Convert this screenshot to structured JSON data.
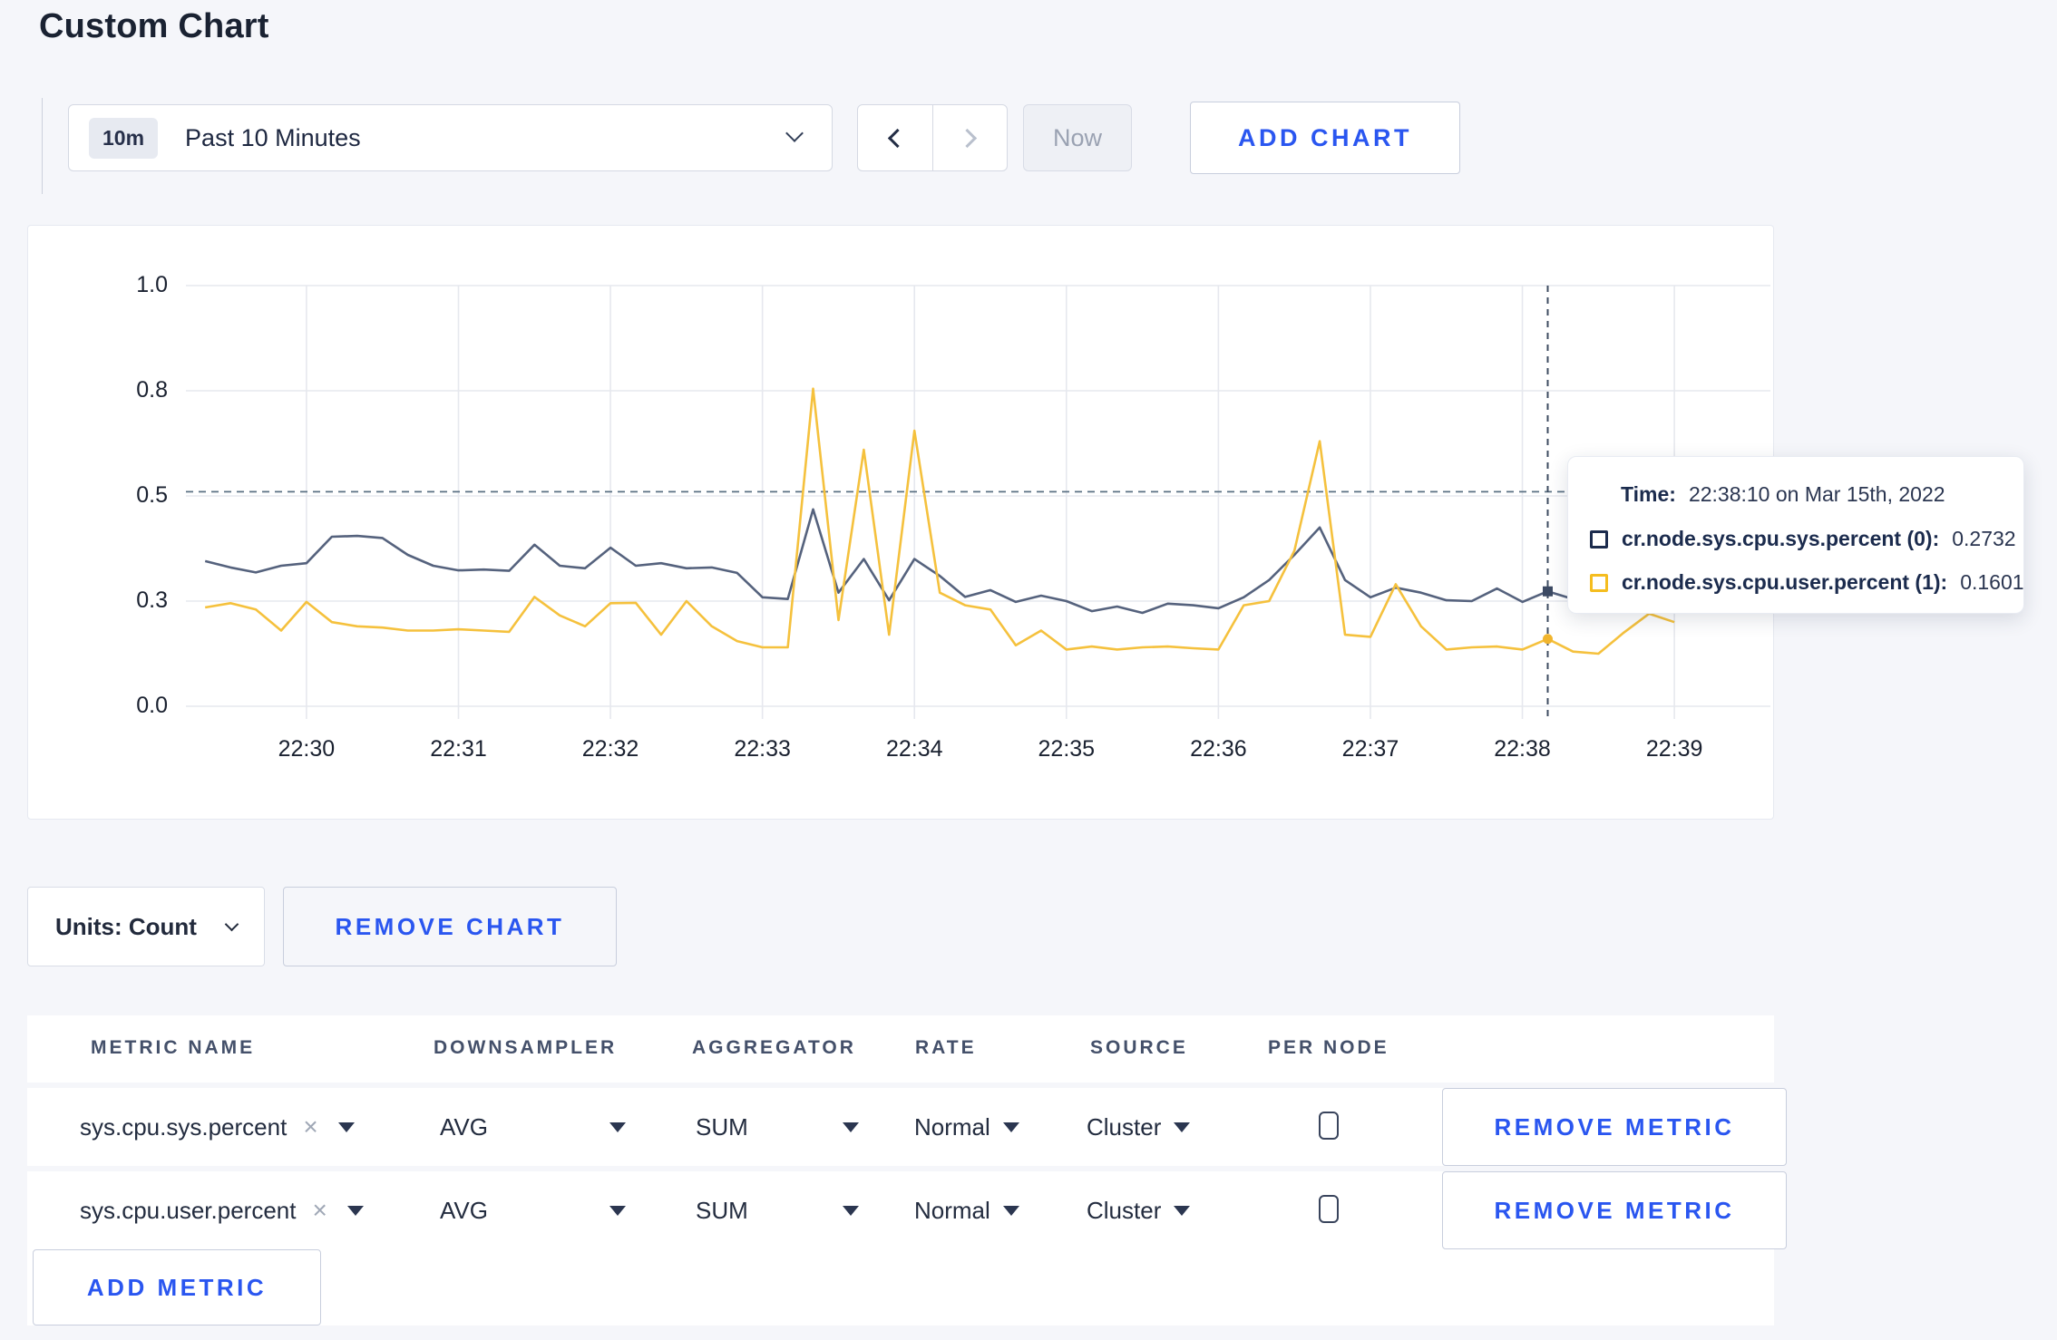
{
  "page": {
    "title": "Custom Chart"
  },
  "toolbar": {
    "time_badge": "10m",
    "time_label": "Past 10 Minutes",
    "prev_icon": "chevron-left",
    "next_icon": "chevron-right",
    "now_label": "Now",
    "add_chart_label": "ADD CHART"
  },
  "chart": {
    "units_label": "Units: Count",
    "remove_chart_label": "REMOVE CHART",
    "tooltip": {
      "time_label": "Time:",
      "time_value": "22:38:10 on Mar 15th, 2022",
      "series": [
        {
          "label": "cr.node.sys.cpu.sys.percent (0):",
          "value": "0.2732",
          "color": "#1b2b4d"
        },
        {
          "label": "cr.node.sys.cpu.user.percent (1):",
          "value": "0.1601",
          "color": "#f5bd1f"
        }
      ]
    }
  },
  "chart_data": {
    "type": "line",
    "title": "",
    "xlabel": "",
    "ylabel": "",
    "ylim": [
      0,
      1
    ],
    "grid": true,
    "x_start": "22:29:20",
    "x_step_seconds": 10,
    "x_tick_labels": [
      "22:30",
      "22:31",
      "22:32",
      "22:33",
      "22:34",
      "22:35",
      "22:36",
      "22:37",
      "22:38",
      "22:39"
    ],
    "y_ticks": {
      "values": [
        0,
        0.25,
        0.5,
        0.75,
        1.0
      ],
      "labels": [
        "0.0",
        "0.3",
        "0.5",
        "0.8",
        "1.0"
      ]
    },
    "crosshair": {
      "time": "22:38:10",
      "point_index": 53,
      "y_value": 0.51
    },
    "colors": {
      "grid": "#e6e8ee",
      "crosshair_h": "#5a7083",
      "crosshair_v": "#3d4b60"
    },
    "series": [
      {
        "name": "cr.node.sys.cpu.sys.percent",
        "color": "#55627d",
        "marker": "square",
        "values": [
          0.345,
          0.33,
          0.318,
          0.334,
          0.34,
          0.403,
          0.405,
          0.4,
          0.36,
          0.334,
          0.323,
          0.325,
          0.322,
          0.384,
          0.334,
          0.328,
          0.377,
          0.334,
          0.34,
          0.328,
          0.33,
          0.317,
          0.259,
          0.255,
          0.468,
          0.27,
          0.35,
          0.252,
          0.35,
          0.31,
          0.26,
          0.276,
          0.248,
          0.263,
          0.25,
          0.226,
          0.237,
          0.222,
          0.244,
          0.24,
          0.233,
          0.259,
          0.3,
          0.36,
          0.425,
          0.3,
          0.259,
          0.282,
          0.27,
          0.252,
          0.25,
          0.28,
          0.248,
          0.2732,
          0.255,
          0.26,
          0.265,
          0.258,
          0.262
        ]
      },
      {
        "name": "cr.node.sys.cpu.user.percent",
        "color": "#f5c13d",
        "marker": "circle",
        "values": [
          0.235,
          0.245,
          0.23,
          0.18,
          0.248,
          0.2,
          0.19,
          0.187,
          0.18,
          0.18,
          0.183,
          0.18,
          0.177,
          0.26,
          0.216,
          0.19,
          0.245,
          0.246,
          0.17,
          0.25,
          0.19,
          0.155,
          0.14,
          0.14,
          0.755,
          0.205,
          0.61,
          0.17,
          0.655,
          0.27,
          0.24,
          0.23,
          0.145,
          0.18,
          0.135,
          0.142,
          0.135,
          0.14,
          0.142,
          0.138,
          0.135,
          0.24,
          0.25,
          0.37,
          0.63,
          0.17,
          0.165,
          0.29,
          0.19,
          0.135,
          0.14,
          0.142,
          0.135,
          0.1601,
          0.13,
          0.125,
          0.175,
          0.22,
          0.2
        ]
      }
    ]
  },
  "metrics_table": {
    "headers": [
      "METRIC NAME",
      "DOWNSAMPLER",
      "AGGREGATOR",
      "RATE",
      "SOURCE",
      "PER NODE"
    ],
    "remove_glyph": "×",
    "rows": [
      {
        "metric": "sys.cpu.sys.percent",
        "downsampler": "AVG",
        "aggregator": "SUM",
        "rate": "Normal",
        "source": "Cluster",
        "per_node_checked": false,
        "remove_label": "REMOVE METRIC"
      },
      {
        "metric": "sys.cpu.user.percent",
        "downsampler": "AVG",
        "aggregator": "SUM",
        "rate": "Normal",
        "source": "Cluster",
        "per_node_checked": false,
        "remove_label": "REMOVE METRIC"
      }
    ],
    "add_metric_label": "ADD METRIC"
  }
}
